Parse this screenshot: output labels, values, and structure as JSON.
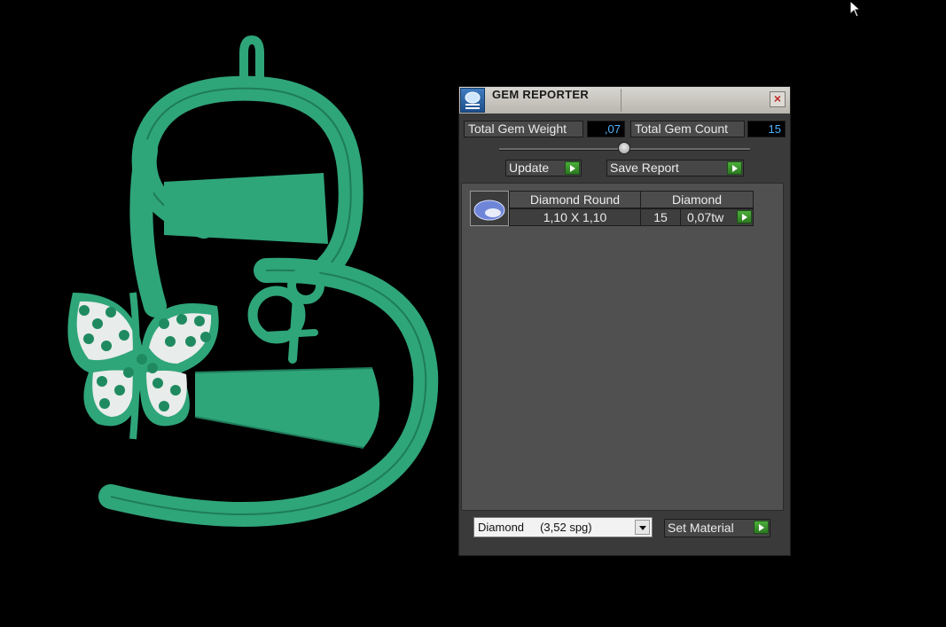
{
  "gem_reporter": {
    "title": "GEM REPORTER",
    "total_gem_weight_label": "Total Gem Weight",
    "total_gem_weight_value": ",07",
    "total_gem_count_label": "Total Gem Count",
    "total_gem_count_value": "15",
    "update_label": "Update",
    "save_report_label": "Save Report",
    "table": {
      "headers": [
        "Diamond Round",
        "Diamond"
      ],
      "rows": [
        {
          "size": "1,10 X 1,10",
          "count": "15",
          "weight": "0,07tw"
        }
      ]
    },
    "material_select": {
      "value": "Diamond     (3,52 spg)"
    },
    "set_material_label": "Set Material"
  },
  "colors": {
    "model_green": "#2fa57a",
    "panel_bg": "#3a3a3a",
    "list_bg": "#505050",
    "value_text": "#4fb3ff",
    "go_button": "#3a9a2e"
  }
}
